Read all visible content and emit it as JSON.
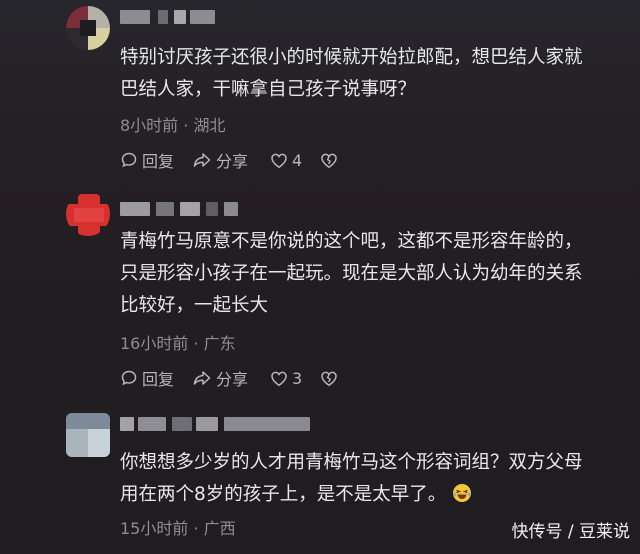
{
  "comments": [
    {
      "text_lines": [
        "特别讨厌孩子还很小的时候就开始拉郎配，想巴结人家就",
        "巴结人家，干嘛拿自己孩子说事呀？"
      ],
      "time_location": "8小时前 · 湖北",
      "reply_label": "回复",
      "share_label": "分享",
      "like_count": "4"
    },
    {
      "text_lines": [
        "青梅竹马原意不是你说的这个吧，这都不是形容年龄的，",
        "只是形容小孩子在一起玩。现在是大部人认为幼年的关系",
        "比较好，一起长大"
      ],
      "time_location": "16小时前 · 广东",
      "reply_label": "回复",
      "share_label": "分享",
      "like_count": "3"
    },
    {
      "text_lines": [
        "你想想多少岁的人才用青梅竹马这个形容词组？双方父母",
        "用在两个8岁的孩子上，是不是太早了。"
      ],
      "time_location": "15小时前 · 广西"
    }
  ],
  "icons": {
    "reply": "comment-bubble-icon",
    "share": "share-arrow-icon",
    "like": "heart-outline-icon",
    "dislike": "broken-heart-icon",
    "emoji": "laughing-tears-emoji"
  },
  "watermark": "快传号 / 豆莱说",
  "colors": {
    "background": "#232024",
    "text": "#e8e8ea",
    "meta": "#8e8d93",
    "action": "#b6b5bb"
  }
}
